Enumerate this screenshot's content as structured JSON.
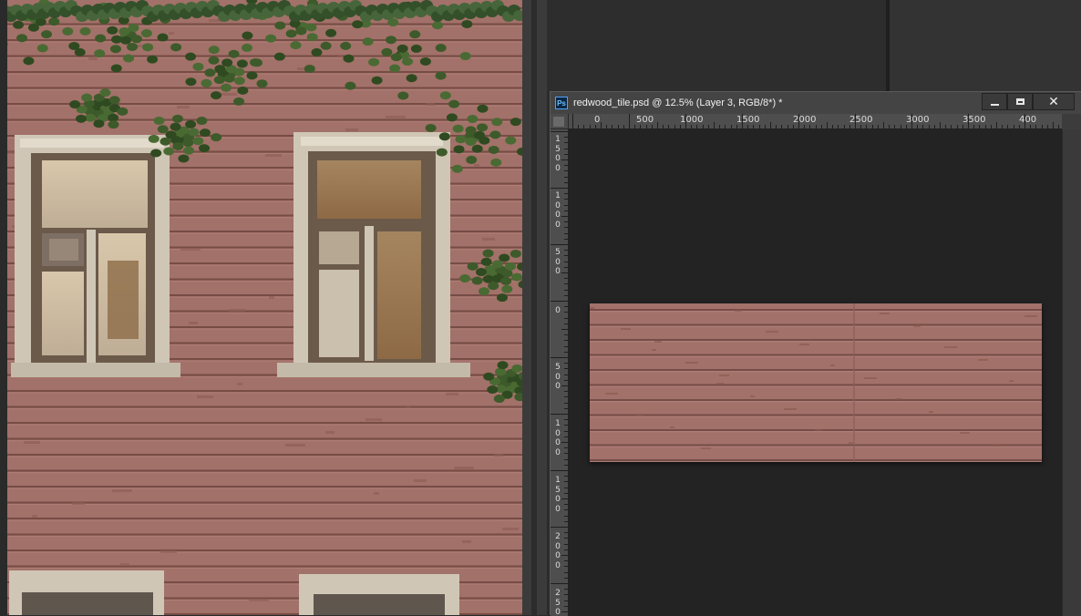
{
  "document": {
    "icon_label": "Ps",
    "title": "redwood_tile.psd @ 12.5% (Layer 3, RGB/8*) *"
  },
  "window_controls": {
    "minimize": "minimize",
    "maximize": "maximize",
    "close": "✕"
  },
  "horizontal_ruler": {
    "labels": [
      "0",
      "500",
      "1000",
      "1500",
      "2000",
      "2500",
      "3000",
      "3500",
      "400"
    ]
  },
  "vertical_ruler": {
    "labels": [
      "1500",
      "1000",
      "500",
      "0",
      "500",
      "1000",
      "1500",
      "2000",
      "2500"
    ]
  },
  "icons": {
    "app": "photoshop-icon",
    "minimize": "minimize-icon",
    "maximize": "maximize-icon",
    "close": "close-icon"
  },
  "colors": {
    "wood": "#a27169",
    "workspace": "#232323",
    "titlebar": "#444444"
  }
}
